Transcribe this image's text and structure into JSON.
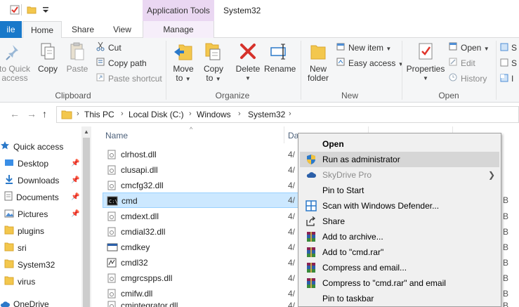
{
  "window": {
    "title": "System32",
    "context_tab_header": "Application Tools"
  },
  "tabs": [
    {
      "label": "ile"
    },
    {
      "label": "Home"
    },
    {
      "label": "Share"
    },
    {
      "label": "View"
    },
    {
      "label": "Manage"
    }
  ],
  "ribbon": {
    "clipboard": {
      "pin_label_1": "to Quick",
      "pin_label_2": "access",
      "copy": "Copy",
      "paste": "Paste",
      "cut": "Cut",
      "copy_path": "Copy path",
      "paste_shortcut": "Paste shortcut",
      "group": "Clipboard"
    },
    "organize": {
      "move_to_1": "Move",
      "move_to_2": "to",
      "copy_to_1": "Copy",
      "copy_to_2": "to",
      "delete": "Delete",
      "rename": "Rename",
      "group": "Organize"
    },
    "new": {
      "new_folder_1": "New",
      "new_folder_2": "folder",
      "new_item": "New item",
      "easy_access": "Easy access",
      "group": "New"
    },
    "open": {
      "properties": "Properties",
      "open": "Open",
      "edit": "Edit",
      "history": "History",
      "group": "Open"
    },
    "select": {
      "s1": "S",
      "s2": "S",
      "s3": "I"
    }
  },
  "address": {
    "crumbs": [
      "This PC",
      "Local Disk (C:)",
      "Windows",
      "System32"
    ]
  },
  "nav_pane": {
    "items": [
      {
        "label": "Quick access",
        "pinned": false
      },
      {
        "label": "Desktop",
        "pinned": true
      },
      {
        "label": "Downloads",
        "pinned": true
      },
      {
        "label": "Documents",
        "pinned": true
      },
      {
        "label": "Pictures",
        "pinned": true
      },
      {
        "label": "plugins",
        "pinned": false
      },
      {
        "label": "sri",
        "pinned": false
      },
      {
        "label": "System32",
        "pinned": false
      },
      {
        "label": "virus",
        "pinned": false
      },
      {
        "label": "OneDrive",
        "pinned": false
      }
    ]
  },
  "file_list": {
    "columns": {
      "name": "Name",
      "date": "Da"
    },
    "rows": [
      {
        "name": "clrhost.dll",
        "date": "4/",
        "size": ""
      },
      {
        "name": "clusapi.dll",
        "date": "4/",
        "size": ""
      },
      {
        "name": "cmcfg32.dll",
        "date": "4/",
        "size": ""
      },
      {
        "name": "cmd",
        "date": "4/",
        "size": "B",
        "selected": true
      },
      {
        "name": "cmdext.dll",
        "date": "4/",
        "size": "B"
      },
      {
        "name": "cmdial32.dll",
        "date": "4/",
        "size": "B"
      },
      {
        "name": "cmdkey",
        "date": "4/",
        "size": "B"
      },
      {
        "name": "cmdl32",
        "date": "4/",
        "size": "B"
      },
      {
        "name": "cmgrcspps.dll",
        "date": "4/",
        "size": "B"
      },
      {
        "name": "cmifw.dll",
        "date": "4/",
        "size": "B"
      },
      {
        "name": "cmintegrator.dll",
        "date": "4/",
        "size": "B"
      }
    ]
  },
  "context_menu": {
    "items": [
      {
        "label": "Open",
        "bold": true
      },
      {
        "label": "Run as administrator",
        "hover": true,
        "icon": "shield"
      },
      {
        "label": "SkyDrive Pro",
        "dim": true,
        "icon": "cloud",
        "submenu": true
      },
      {
        "label": "Pin to Start"
      },
      {
        "label": "Scan with Windows Defender...",
        "icon": "defender"
      },
      {
        "label": "Share",
        "icon": "share"
      },
      {
        "label": "Add to archive...",
        "icon": "rar"
      },
      {
        "label": "Add to \"cmd.rar\"",
        "icon": "rar"
      },
      {
        "label": "Compress and email...",
        "icon": "rar"
      },
      {
        "label": "Compress to \"cmd.rar\" and email",
        "icon": "rar"
      },
      {
        "label": "Pin to taskbar"
      }
    ]
  },
  "colors": {
    "file_tab": "#1979ca",
    "selection": "#cce8ff",
    "context_tab": "#ead7f2"
  }
}
